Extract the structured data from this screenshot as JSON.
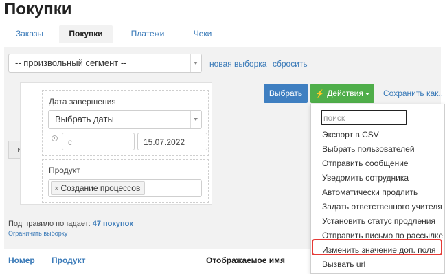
{
  "page": {
    "title": "Покупки"
  },
  "tabs": [
    {
      "label": "Заказы",
      "active": false
    },
    {
      "label": "Покупки",
      "active": true
    },
    {
      "label": "Платежи",
      "active": false
    },
    {
      "label": "Чеки",
      "active": false
    }
  ],
  "segment": {
    "selected": "-- произвольный сегмент --",
    "new_selection": "новая выборка",
    "reset": "сбросить"
  },
  "rule": {
    "and_label": "и",
    "end_date": {
      "label": "Дата завершения",
      "select": "Выбрать даты",
      "from_placeholder": "с",
      "to_value": "15.07.2022"
    },
    "product": {
      "label": "Продукт",
      "tag": "Создание процессов",
      "tag_remove": "×"
    }
  },
  "buttons": {
    "choose": "Выбрать",
    "actions_icon": "⚡",
    "actions": "Действия",
    "save_as": "Сохранить как..."
  },
  "summary": {
    "prefix": "Под правило попадает:",
    "count": "47 покупок",
    "limit": "Ограничить выборку"
  },
  "table": {
    "columns": [
      "Номер",
      "Продукт",
      "Отображаемое имя"
    ]
  },
  "actions_menu": {
    "search_placeholder": "поиск",
    "items": [
      "Экспорт в CSV",
      "Выбрать пользователей",
      "Отправить сообщение",
      "Уведомить сотрудника",
      "Автоматически продлить",
      "Задать ответственного учителя",
      "Установить статус продления",
      "Отправить письмо по рассылке",
      "Изменить значение доп. поля",
      "Вызвать url"
    ],
    "highlighted_index": 8
  },
  "icons": {
    "clock": "clock-icon",
    "bolt": "bolt-icon",
    "remove": "remove-tag-icon",
    "caret": "caret-down-icon"
  },
  "colors": {
    "link": "#3a7ab8",
    "primary": "#3f7fc1",
    "success": "#4fae4a",
    "highlight": "#e53935"
  }
}
